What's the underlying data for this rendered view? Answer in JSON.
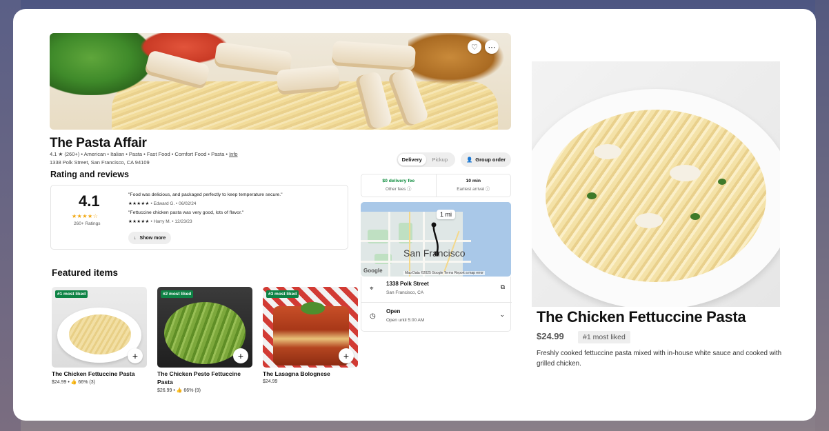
{
  "restaurant": {
    "name": "The Pasta Affair",
    "rating": "4.1",
    "rating_count_short": "(260+)",
    "categories": " • American • Italian • Pasta • Fast Food • Comfort Food • Pasta • ",
    "info_link": "Info",
    "address": "1338 Polk Street, San Francisco, CA 94109"
  },
  "hero": {
    "favorite_icon": "heart-icon",
    "more_icon": "more-icon"
  },
  "order_mode": {
    "delivery": "Delivery",
    "pickup": "Pickup",
    "selected": "Delivery"
  },
  "group_order": {
    "label": "Group order",
    "icon": "person-add-icon"
  },
  "reviews": {
    "section_title": "Rating and reviews",
    "big_rating": "4.1",
    "stars": "★★★★☆",
    "count_label": "260+ Ratings",
    "items": [
      {
        "text": "\"Food was delicious, and packaged perfectly to keep temperature secure.\"",
        "stars": "★★★★★",
        "meta": " • Edward G. • 06/02/24"
      },
      {
        "text": "\"Fettuccine chicken pasta was very good, lots of flavor.\"",
        "stars": "★★★★★",
        "meta": " • Harry M. • 12/23/23"
      }
    ],
    "show_more": "Show more"
  },
  "fees": {
    "delivery_fee": "$0 delivery fee",
    "other_fees": "Other fees ⓘ",
    "arrival": "10 min",
    "arrival_sub": "Earliest arrival ⓘ"
  },
  "map": {
    "city_label": "San Francisco",
    "distance": "1 mi",
    "google": "Google",
    "footer": "Map Data ©2025 Google    Terms    Report a map error"
  },
  "location": {
    "address": "1338 Polk Street",
    "city": "San Francisco, CA",
    "status": "Open",
    "hours": "Open until 5:00 AM"
  },
  "featured": {
    "section_title": "Featured items",
    "items": [
      {
        "badge": "#1 most liked",
        "name": "The Chicken Fettuccine Pasta",
        "price": "$24.99 • 👍 66% (3)"
      },
      {
        "badge": "#2 most liked",
        "name": "The Chicken Pesto Fettuccine Pasta",
        "price": "$26.99 • 👍 66% (9)"
      },
      {
        "badge": "#3 most liked",
        "name": "The Lasagna Bolognese",
        "price": "$24.99"
      }
    ]
  },
  "detail": {
    "title": "The Chicken Fettuccine Pasta",
    "price": "$24.99",
    "badge": "#1 most liked",
    "description": "Freshly cooked fettuccine pasta mixed with in-house white sauce and cooked with grilled chicken."
  },
  "colors": {
    "accent_green": "#0e8345",
    "star_yellow": "#f2a60c"
  }
}
